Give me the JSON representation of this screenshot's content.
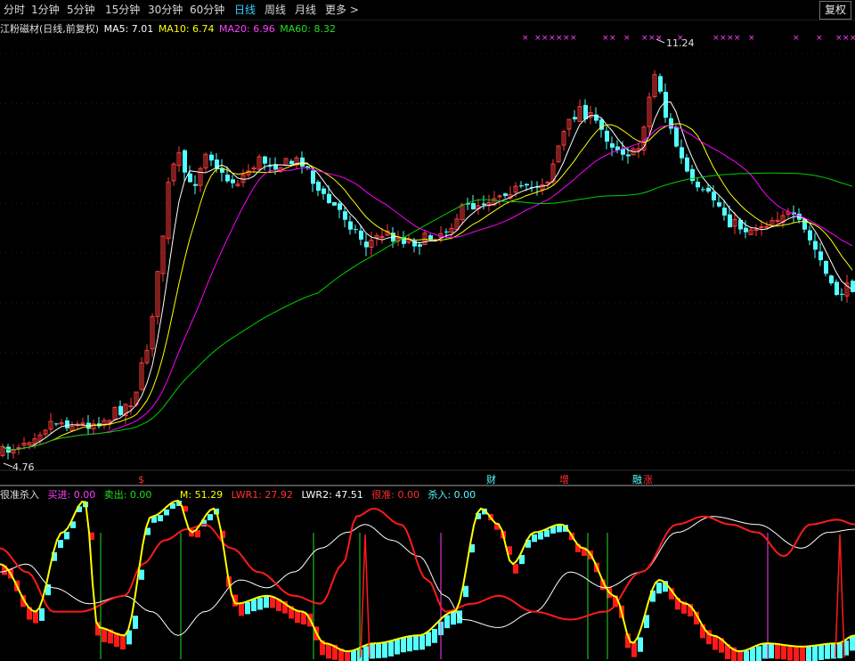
{
  "toolbar": {
    "timeframes": [
      {
        "label": "分时",
        "active": false
      },
      {
        "label": "1分钟",
        "active": false
      },
      {
        "label": "5分钟",
        "active": false
      },
      {
        "label": "15分钟",
        "active": false
      },
      {
        "label": "30分钟",
        "active": false
      },
      {
        "label": "60分钟",
        "active": false
      },
      {
        "label": "日线",
        "active": true
      },
      {
        "label": "周线",
        "active": false
      },
      {
        "label": "月线",
        "active": false
      },
      {
        "label": "更多 >",
        "active": false
      }
    ],
    "fq_button": "复权"
  },
  "main_legend": {
    "title": "江粉磁材(日线,前复权)",
    "ma5": "MA5: 7.01",
    "ma10": "MA10: 6.74",
    "ma20": "MA20: 6.96",
    "ma60": "MA60: 8.32"
  },
  "price_labels": {
    "high": "11.24",
    "low": "4.76"
  },
  "event_markers": [
    "$",
    "财",
    "增",
    "融",
    "涨"
  ],
  "indicator_legend": {
    "name": "很准杀入",
    "buy": "买进: 0.00",
    "sell": "卖出: 0.00",
    "m": "M: 51.29",
    "lwr1": "LWR1: 27.92",
    "lwr2": "LWR2: 47.51",
    "hz": "很准: 0.00",
    "sr": "杀入: 0.00"
  },
  "colors": {
    "up": "#ff3c3c",
    "down": "#54ffff",
    "ma5": "#ffffff",
    "ma10": "#ffff00",
    "ma20": "#ff00ff",
    "ma60": "#00d000",
    "active": "#3ad0ff"
  }
}
